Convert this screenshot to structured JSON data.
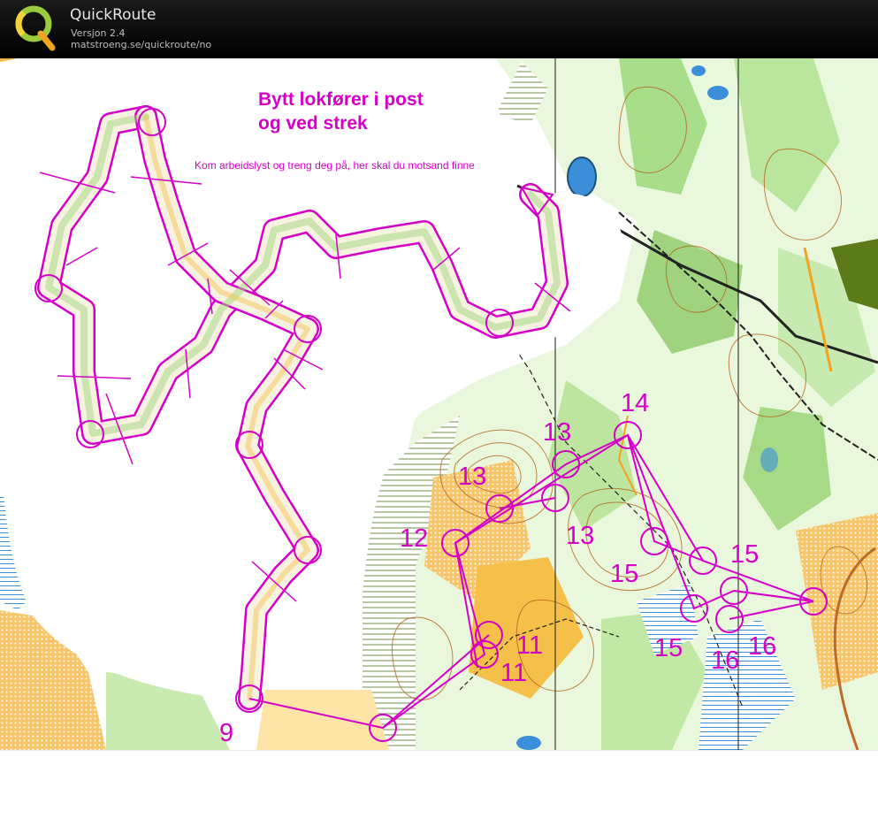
{
  "app": {
    "name": "QuickRoute",
    "version": "Versjon 2.4",
    "url": "matstroeng.se/quickroute/no"
  },
  "map": {
    "heading_line1": "Bytt lokfører i post",
    "heading_line2": "og ved strek",
    "subtext": "Kom arbeidslyst og treng deg på, her skal du motsand finne",
    "control_labels": [
      "14",
      "13",
      "13",
      "12",
      "13",
      "15",
      "15",
      "11",
      "11",
      "15",
      "16",
      "16",
      "9"
    ]
  },
  "colors": {
    "overprint": "#d400c8",
    "forest": "#ffffff",
    "green": "#8fd16a",
    "open": "#f5b73c",
    "water": "#3a8fd8",
    "contour": "#b5651d",
    "titlebar": "#000000"
  }
}
